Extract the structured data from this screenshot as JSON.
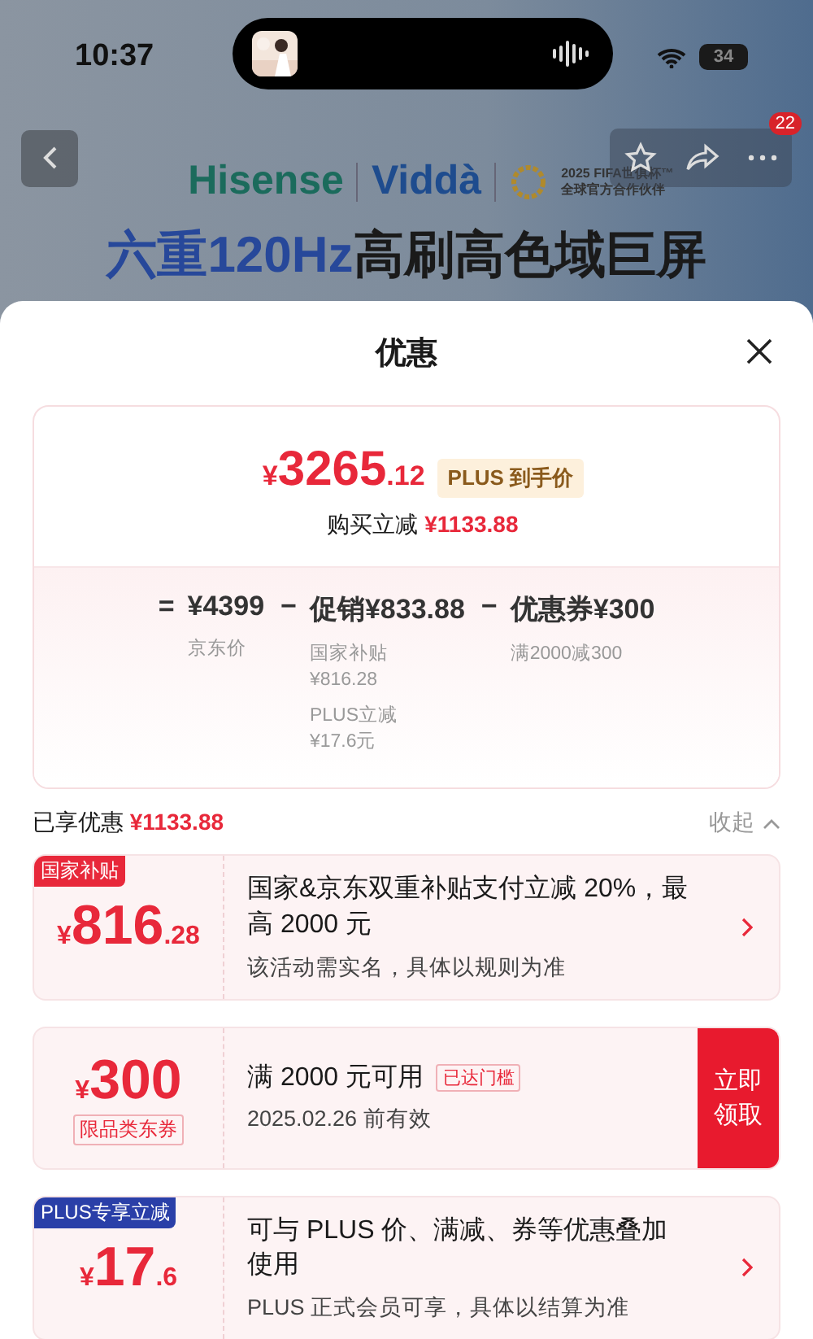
{
  "status_bar": {
    "time": "10:37",
    "battery": "34"
  },
  "banner": {
    "brands": [
      "Hisense",
      "Viddà"
    ],
    "partner_lines": [
      "2025 FIFA世俱杯™",
      "全球官方合作伙伴"
    ],
    "headline_highlight": "六重120Hz",
    "headline_rest": "高刷高色域巨屏"
  },
  "nav": {
    "badge": "22"
  },
  "sheet": {
    "title": "优惠"
  },
  "summary": {
    "price_symbol": "¥",
    "price_int": "3265",
    "price_dec": ".12",
    "price_tag": "PLUS 到手价",
    "saving_label": "购买立减",
    "saving_amount": "¥1133.88",
    "breakdown": [
      {
        "operator": "=",
        "amount": "¥4399",
        "notes": [
          [
            "京东价"
          ]
        ]
      },
      {
        "operator": "−",
        "amount": "促销¥833.88",
        "notes": [
          [
            "国家补贴",
            "¥816.28"
          ],
          [
            "PLUS立减",
            "¥17.6元"
          ]
        ]
      },
      {
        "operator": "−",
        "amount": "优惠券¥300",
        "notes": [
          [
            "满2000减300"
          ]
        ]
      }
    ]
  },
  "enjoyed": {
    "label": "已享优惠",
    "amount": "¥1133.88",
    "toggle": "收起",
    "expanded": true
  },
  "offers": [
    {
      "kind": "subsidy",
      "tag": "国家补贴",
      "color": "#e8283a",
      "symbol": "¥",
      "int": "816",
      "dec": ".28",
      "title": "国家&京东双重补贴支付立减 20%，最高 2000 元",
      "subtitle": "该活动需实名，具体以规则为准"
    },
    {
      "kind": "coupon",
      "symbol": "¥",
      "int": "300",
      "label": "限品类东券",
      "title": "满 2000 元可用",
      "badge": "已达门槛",
      "subtitle": "2025.02.26 前有效",
      "action": "立即领取"
    },
    {
      "kind": "subsidy",
      "tag": "PLUS专享立减",
      "color": "#2a3fa8",
      "symbol": "¥",
      "int": "17",
      "dec": ".6",
      "title": "可与 PLUS 价、满减、券等优惠叠加使用",
      "subtitle": "PLUS 正式会员可享，具体以结算为准"
    }
  ]
}
